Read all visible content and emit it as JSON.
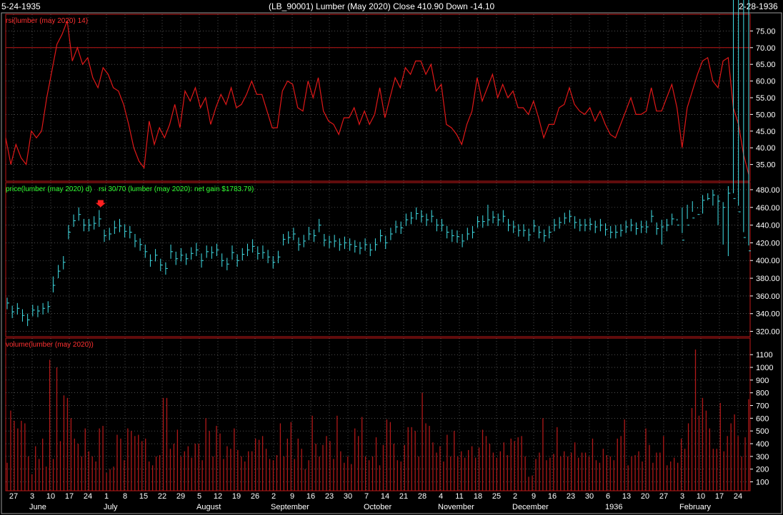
{
  "header": {
    "start_date": "5-24-1935",
    "title": "(LB_90001)  Lumber (May 2020)    Close 410.90   Down -14.10",
    "end_date": "2-28-1936"
  },
  "colors": {
    "background": "#000000",
    "rsi_line": "#e01818",
    "price_bars": "#40e0e8",
    "volume_bars": "#b01818",
    "panel_border": "#c01818",
    "grid": "#808080",
    "rsi_label": "#ff3030",
    "strategy_label": "#30ff30",
    "volume_label": "#ff3030",
    "signal_arrow": "#ff2020"
  },
  "chart_data": [
    {
      "panel": "rsi",
      "type": "line",
      "label": "rsi(lumber (may 2020) 14)",
      "ylim": [
        30,
        80
      ],
      "yticks": [
        35,
        40,
        45,
        50,
        55,
        60,
        65,
        70,
        75
      ],
      "ytick_labels": [
        "35.00",
        "40.00",
        "45.00",
        "50.00",
        "55.00",
        "60.00",
        "65.00",
        "70.00",
        "75.00"
      ],
      "reference_line": 70,
      "values": [
        43,
        35,
        41,
        37,
        35,
        45,
        43,
        45,
        55,
        63,
        71,
        74,
        78,
        66,
        70,
        65,
        67,
        61,
        58,
        64,
        62,
        58,
        57,
        53,
        47,
        40,
        36,
        34,
        48,
        41,
        46,
        43,
        47,
        53,
        46,
        57,
        54,
        58,
        52,
        55,
        47,
        52,
        56,
        53,
        58,
        52,
        53,
        56,
        60,
        56,
        56,
        51,
        46,
        46,
        57,
        60,
        59,
        52,
        51,
        60,
        55,
        61,
        51,
        48,
        47,
        44,
        49,
        49,
        52,
        47,
        51,
        47,
        50,
        58,
        49,
        55,
        61,
        58,
        64,
        62,
        66,
        66,
        62,
        65,
        57,
        59,
        47,
        46,
        44,
        41,
        47,
        51,
        61,
        54,
        58,
        62,
        55,
        59,
        55,
        57,
        52,
        52,
        50,
        54,
        49,
        43,
        47,
        47,
        52,
        53,
        58,
        53,
        51,
        50,
        52,
        48,
        51,
        47,
        44,
        43,
        47,
        51,
        55,
        50,
        50,
        51,
        58,
        51,
        51,
        55,
        59,
        52,
        40,
        52,
        57,
        62,
        66,
        67,
        60,
        58,
        66,
        67,
        52,
        47,
        38,
        32
      ]
    },
    {
      "panel": "price",
      "type": "bar",
      "label": "price(lumber (may 2020) d)",
      "strategy_label": "rsi 30/70 (lumber (may 2020): net gain $1783.79)",
      "ylim": [
        314,
        488
      ],
      "yticks": [
        320,
        340,
        360,
        380,
        400,
        420,
        440,
        460,
        480
      ],
      "ytick_labels": [
        "320.00",
        "340.00",
        "360.00",
        "380.00",
        "400.00",
        "420.00",
        "440.00",
        "460.00",
        "480.00"
      ],
      "sell_signal_index": 18,
      "close": [
        352,
        342,
        346,
        338,
        333,
        344,
        343,
        346,
        348,
        372,
        388,
        398,
        432,
        445,
        452,
        440,
        440,
        442,
        447,
        428,
        430,
        437,
        439,
        433,
        432,
        422,
        418,
        410,
        400,
        406,
        395,
        391,
        410,
        402,
        406,
        402,
        408,
        412,
        400,
        410,
        409,
        412,
        400,
        396,
        409,
        400,
        407,
        412,
        416,
        408,
        409,
        404,
        398,
        404,
        424,
        426,
        430,
        418,
        422,
        430,
        428,
        440,
        423,
        421,
        422,
        418,
        420,
        418,
        416,
        414,
        418,
        412,
        418,
        428,
        420,
        430,
        438,
        437,
        446,
        448,
        453,
        450,
        446,
        450,
        440,
        440,
        432,
        428,
        427,
        422,
        430,
        432,
        444,
        444,
        446,
        449,
        446,
        450,
        440,
        438,
        434,
        434,
        429,
        439,
        432,
        428,
        432,
        440,
        443,
        448,
        450,
        443,
        440,
        440,
        441,
        438,
        440,
        435,
        432,
        432,
        434,
        438,
        440,
        436,
        438,
        438,
        450,
        436,
        438,
        440,
        447,
        440,
        423,
        440,
        448,
        452,
        468,
        470,
        474,
        467,
        460,
        476,
        470,
        455,
        426,
        410.9
      ],
      "high": [
        358,
        349,
        352,
        345,
        340,
        350,
        349,
        352,
        354,
        382,
        395,
        405,
        440,
        452,
        460,
        447,
        447,
        450,
        457,
        435,
        437,
        445,
        447,
        441,
        439,
        430,
        425,
        418,
        407,
        413,
        402,
        398,
        418,
        410,
        414,
        408,
        415,
        420,
        408,
        417,
        416,
        419,
        408,
        403,
        417,
        407,
        414,
        419,
        424,
        416,
        417,
        412,
        405,
        411,
        430,
        433,
        437,
        426,
        429,
        438,
        435,
        447,
        430,
        428,
        429,
        425,
        427,
        425,
        423,
        421,
        425,
        419,
        425,
        435,
        428,
        437,
        445,
        444,
        453,
        455,
        460,
        457,
        453,
        457,
        447,
        447,
        439,
        435,
        434,
        430,
        437,
        439,
        450,
        451,
        463,
        456,
        453,
        457,
        447,
        445,
        441,
        441,
        436,
        446,
        439,
        435,
        439,
        447,
        449,
        454,
        457,
        450,
        447,
        447,
        448,
        445,
        447,
        442,
        439,
        440,
        441,
        445,
        447,
        443,
        445,
        445,
        457,
        443,
        446,
        447,
        453,
        447,
        431,
        447,
        455,
        459,
        474,
        476,
        480,
        474,
        466,
        484,
        476,
        462,
        432,
        417
      ],
      "low": [
        345,
        335,
        339,
        331,
        326,
        337,
        336,
        339,
        341,
        364,
        380,
        390,
        424,
        438,
        445,
        433,
        433,
        435,
        438,
        421,
        423,
        430,
        432,
        426,
        425,
        415,
        411,
        403,
        393,
        399,
        388,
        384,
        402,
        395,
        399,
        395,
        401,
        405,
        392,
        403,
        402,
        405,
        393,
        389,
        401,
        393,
        400,
        405,
        409,
        401,
        402,
        397,
        391,
        397,
        417,
        419,
        423,
        411,
        415,
        423,
        421,
        432,
        416,
        414,
        415,
        411,
        413,
        411,
        409,
        407,
        411,
        405,
        411,
        421,
        413,
        423,
        431,
        430,
        439,
        441,
        446,
        443,
        439,
        443,
        433,
        433,
        425,
        421,
        420,
        415,
        423,
        425,
        437,
        437,
        439,
        442,
        439,
        443,
        433,
        431,
        427,
        427,
        422,
        432,
        425,
        421,
        425,
        433,
        436,
        441,
        443,
        436,
        433,
        433,
        434,
        431,
        433,
        428,
        425,
        425,
        427,
        431,
        433,
        429,
        431,
        431,
        443,
        429,
        418,
        433,
        440,
        445,
        460,
        463,
        467,
        460,
        453,
        468,
        462,
        440,
        418,
        405
      ]
    },
    {
      "panel": "volume",
      "type": "bar",
      "label": "volume(lumber (may 2020))",
      "ylim": [
        30,
        1230
      ],
      "yticks": [
        100,
        200,
        300,
        400,
        500,
        600,
        700,
        800,
        900,
        1000,
        1100
      ],
      "ytick_labels": [
        "100",
        "200",
        "300",
        "400",
        "500",
        "600",
        "700",
        "800",
        "900",
        "1000",
        "1100"
      ],
      "values": [
        250,
        660,
        580,
        520,
        580,
        560,
        300,
        160,
        380,
        280,
        440,
        220,
        1060,
        280,
        1000,
        420,
        780,
        760,
        600,
        440,
        400,
        300,
        520,
        340,
        300,
        260,
        520,
        540,
        170,
        200,
        220,
        470,
        440,
        270,
        520,
        500,
        460,
        470,
        420,
        440,
        260,
        230,
        300,
        310,
        760,
        760,
        360,
        400,
        510,
        300,
        340,
        380,
        290,
        400,
        400,
        270,
        600,
        500,
        300,
        540,
        480,
        280,
        380,
        360,
        520,
        350,
        300,
        260,
        340,
        340,
        440,
        430,
        460,
        360,
        280,
        270,
        310,
        560,
        300,
        440,
        570,
        280,
        440,
        360,
        200,
        270,
        620,
        400,
        300,
        390,
        460,
        420,
        280,
        620,
        340,
        250,
        300,
        240,
        520,
        460,
        610,
        300,
        270,
        300,
        450,
        230,
        390,
        590,
        570,
        400,
        270,
        260,
        390,
        530,
        530,
        500,
        300,
        800,
        560,
        540,
        410,
        330,
        380,
        260,
        470,
        300,
        500,
        300,
        340,
        290,
        350,
        380,
        290,
        370,
        510,
        460,
        400,
        330,
        290,
        340,
        410,
        310,
        440,
        420,
        450,
        460,
        300,
        140,
        150,
        280,
        330,
        600,
        270,
        290,
        320,
        530,
        300,
        340,
        300,
        330,
        410,
        290,
        330,
        330,
        300,
        440,
        270,
        250,
        360,
        310,
        300,
        270,
        440,
        460,
        590,
        230,
        300,
        310,
        340,
        260,
        520,
        390,
        250,
        330,
        330,
        460,
        230,
        260,
        290,
        250,
        440,
        360,
        560,
        680,
        1140,
        620,
        760,
        660,
        520,
        360,
        360,
        720,
        340,
        460,
        560,
        630,
        460,
        300,
        450,
        750
      ],
      "bar_count_note": ""
    }
  ],
  "x_axis": {
    "day_ticks": [
      "27",
      "3",
      "10",
      "17",
      "24",
      "1",
      "8",
      "15",
      "22",
      "29",
      "5",
      "12",
      "19",
      "26",
      "2",
      "9",
      "16",
      "23",
      "30",
      "7",
      "14",
      "21",
      "28",
      "4",
      "11",
      "18",
      "25",
      "2",
      "9",
      "16",
      "23",
      "30",
      "6",
      "13",
      "20",
      "27",
      "3",
      "10",
      "17",
      "24"
    ],
    "months": [
      "June",
      "July",
      "August",
      "September",
      "October",
      "November",
      "December",
      "1936",
      "February"
    ],
    "month_start_ticks": [
      1,
      5,
      10,
      14,
      19,
      23,
      27,
      32,
      36
    ]
  }
}
